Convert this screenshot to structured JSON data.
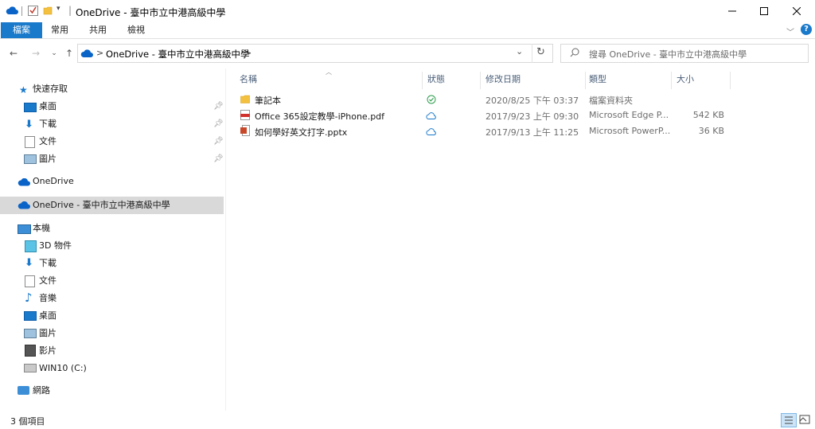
{
  "window": {
    "title_separator": "|",
    "title": "OneDrive - 臺中市立中港高級中學"
  },
  "ribbon": {
    "tabs": [
      "檔案",
      "常用",
      "共用",
      "檢視"
    ]
  },
  "address": {
    "crumb_separator": ">",
    "path": "OneDrive - 臺中市立中港高級中學",
    "trailing_chevron": ">"
  },
  "search": {
    "placeholder": "搜尋 OneDrive - 臺中市立中港高級中學"
  },
  "nav": {
    "quick_access": {
      "label": "快速存取",
      "items": [
        {
          "label": "桌面",
          "icon": "desktop-icon",
          "pinned": true
        },
        {
          "label": "下載",
          "icon": "download-icon",
          "pinned": true
        },
        {
          "label": "文件",
          "icon": "document-icon",
          "pinned": true
        },
        {
          "label": "圖片",
          "icon": "pictures-icon",
          "pinned": true
        }
      ]
    },
    "onedrive": "OneDrive",
    "onedrive_org": "OneDrive - 臺中市立中港高級中學",
    "this_pc": {
      "label": "本機",
      "items": [
        {
          "label": "3D 物件",
          "icon": "3d-objects-icon"
        },
        {
          "label": "下載",
          "icon": "download-icon"
        },
        {
          "label": "文件",
          "icon": "document-icon"
        },
        {
          "label": "音樂",
          "icon": "music-icon"
        },
        {
          "label": "桌面",
          "icon": "desktop-icon"
        },
        {
          "label": "圖片",
          "icon": "pictures-icon"
        },
        {
          "label": "影片",
          "icon": "video-icon"
        },
        {
          "label": "WIN10 (C:)",
          "icon": "drive-icon"
        }
      ]
    },
    "network": "網路"
  },
  "columns": {
    "name": "名稱",
    "status": "狀態",
    "modified": "修改日期",
    "type": "類型",
    "size": "大小"
  },
  "files": [
    {
      "name": "筆記本",
      "icon": "folder-icon",
      "status": "synced-check",
      "modified": "2020/8/25 下午 03:37",
      "type": "檔案資料夾",
      "size": ""
    },
    {
      "name": "Office 365設定教學-iPhone.pdf",
      "icon": "pdf-icon",
      "status": "cloud-only",
      "modified": "2017/9/23 上午 09:30",
      "type": "Microsoft Edge P...",
      "size": "542 KB"
    },
    {
      "name": "如何學好英文打字.pptx",
      "icon": "pptx-icon",
      "status": "cloud-only",
      "modified": "2017/9/13 上午 11:25",
      "type": "Microsoft PowerP...",
      "size": "36 KB"
    }
  ],
  "statusbar": {
    "count": "3 個項目"
  },
  "colors": {
    "accent": "#1979ca",
    "selection": "#d9d9d9",
    "onedrive_blue": "#0a64c8"
  }
}
